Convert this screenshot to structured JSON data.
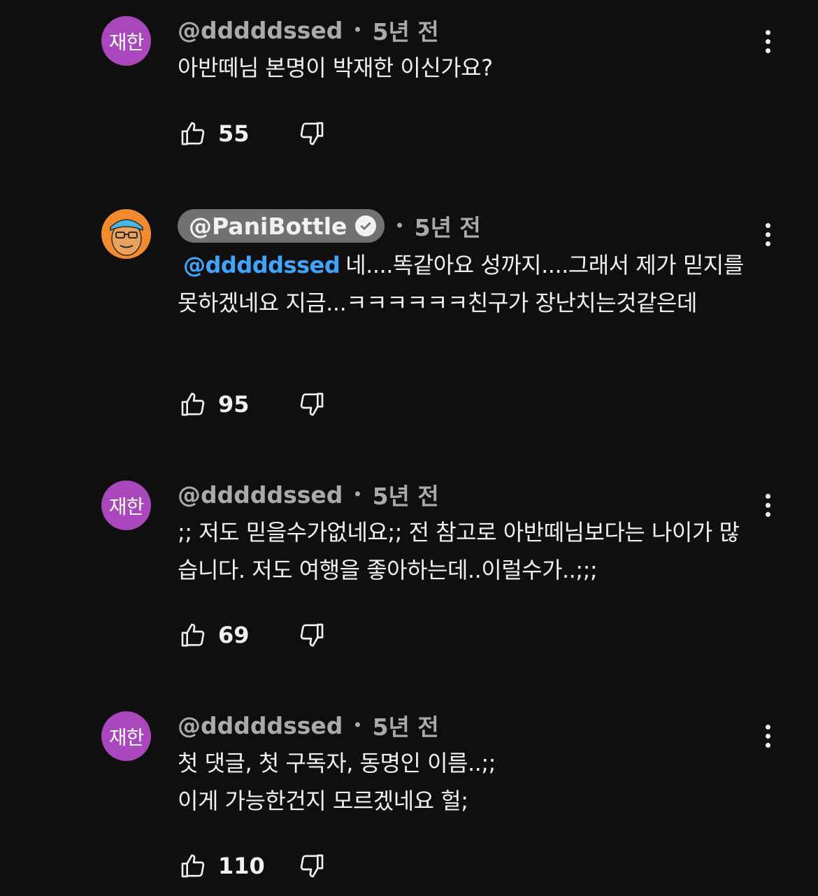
{
  "comments": [
    {
      "avatar_text": "재한",
      "handle": "@dddddssed",
      "separator": "•",
      "time": "5년 전",
      "text": "아반떼님 본명이 박재한 이신가요?",
      "likes": "55"
    },
    {
      "avatar_image": "channel-owner-avatar",
      "handle": "@PaniBottle",
      "verified": true,
      "separator": "•",
      "time": "5년 전",
      "mention": "@dddddssed",
      "text": "네....똑같아요 성까지....그래서 제가 믿지를 못하겠네요 지금...ㅋㅋㅋㅋㅋㅋ친구가 장난치는것같은데",
      "likes": "95"
    },
    {
      "avatar_text": "재한",
      "handle": "@dddddssed",
      "separator": "•",
      "time": "5년 전",
      "text": ";; 저도 믿을수가없네요;; 전 참고로 아반떼님보다는 나이가 많습니다. 저도 여행을 좋아하는데..이럴수가..;;;",
      "likes": "69"
    },
    {
      "avatar_text": "재한",
      "handle": "@dddddssed",
      "separator": "•",
      "time": "5년 전",
      "text_line1": "첫 댓글, 첫 구독자, 동명인 이름..;;",
      "text_line2": "이게 가능한건지 모르겠네요 헐;",
      "likes": "110"
    }
  ],
  "icons": {
    "like": "thumbs-up-icon",
    "dislike": "thumbs-down-icon",
    "menu": "more-vert-icon",
    "verified": "verified-check-icon"
  },
  "colors": {
    "background": "#0f0f0f",
    "avatar_purple": "#ab47bc",
    "mention_blue": "#3ea6ff",
    "secondary_text": "#aaaaaa"
  }
}
